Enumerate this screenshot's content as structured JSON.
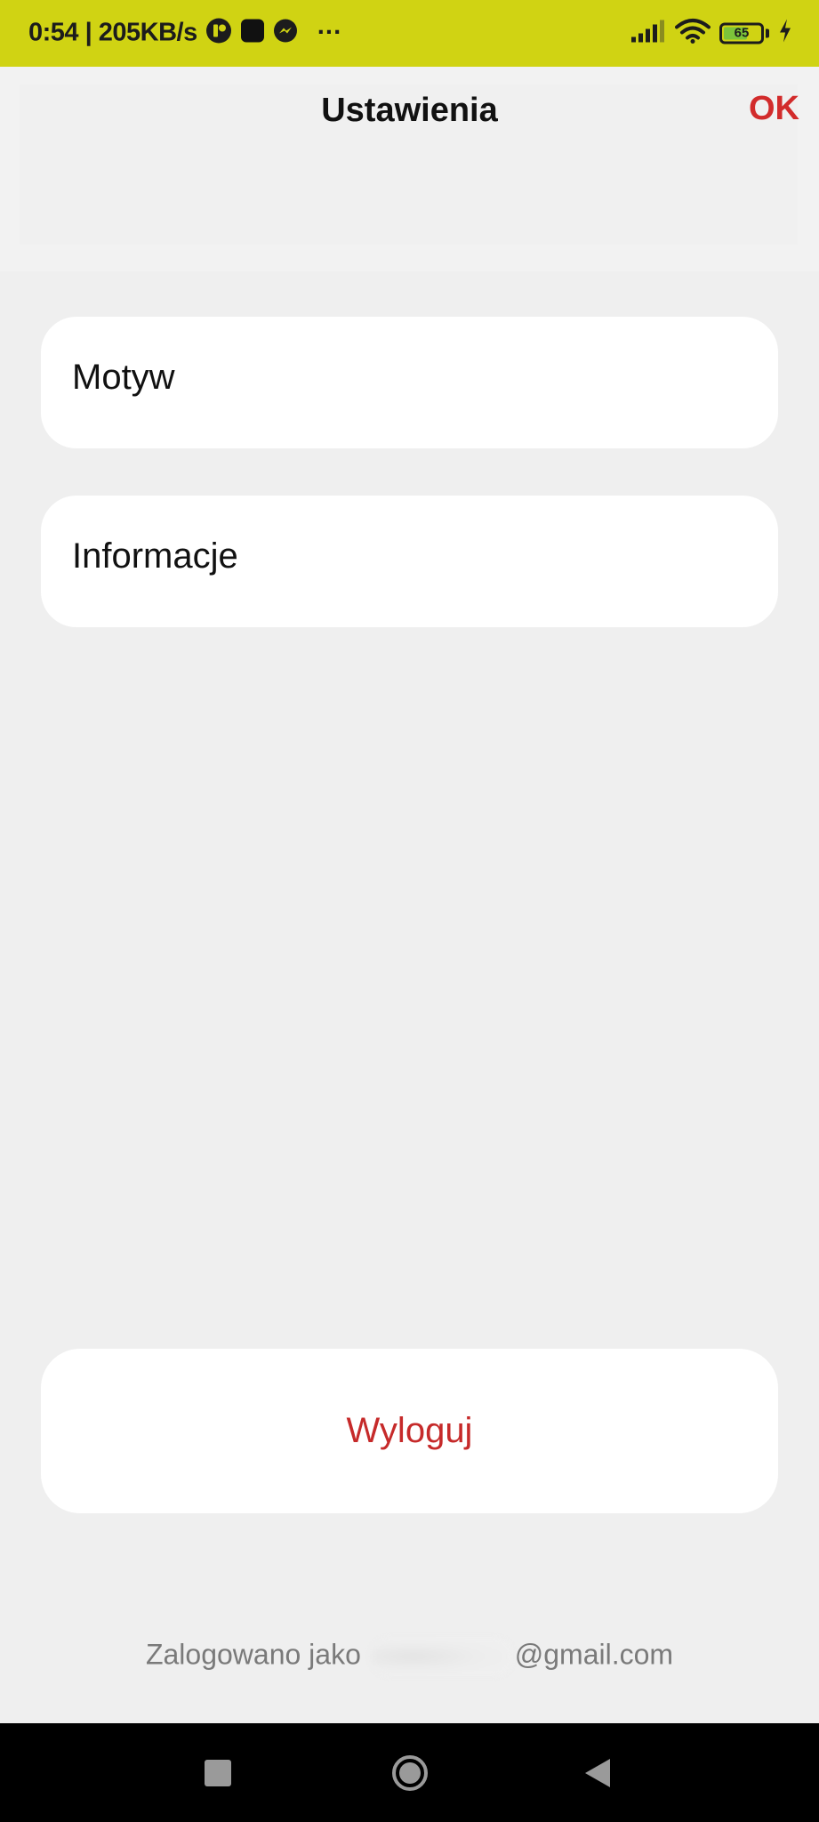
{
  "status_bar": {
    "time": "0:54",
    "network_speed": "205KB/s",
    "notification_icons": [
      "app-notification-icon",
      "app-square-icon",
      "messenger-icon",
      "more-dots-icon"
    ],
    "more_indicator": "···",
    "battery_level": "65",
    "battery_fraction": 0.65,
    "background_color": "#d0d313"
  },
  "header": {
    "title": "Ustawienia",
    "ok_label": "OK",
    "ok_color": "#d22b2b"
  },
  "settings": {
    "items": [
      {
        "label": "Motyw"
      },
      {
        "label": "Informacje"
      }
    ]
  },
  "logout": {
    "label": "Wyloguj",
    "color": "#c62a2a"
  },
  "account": {
    "prefix": "Zalogowano jako",
    "email_domain": "@gmail.com"
  },
  "nav_bar": {
    "buttons": [
      "recents-icon",
      "home-icon",
      "back-icon"
    ]
  }
}
